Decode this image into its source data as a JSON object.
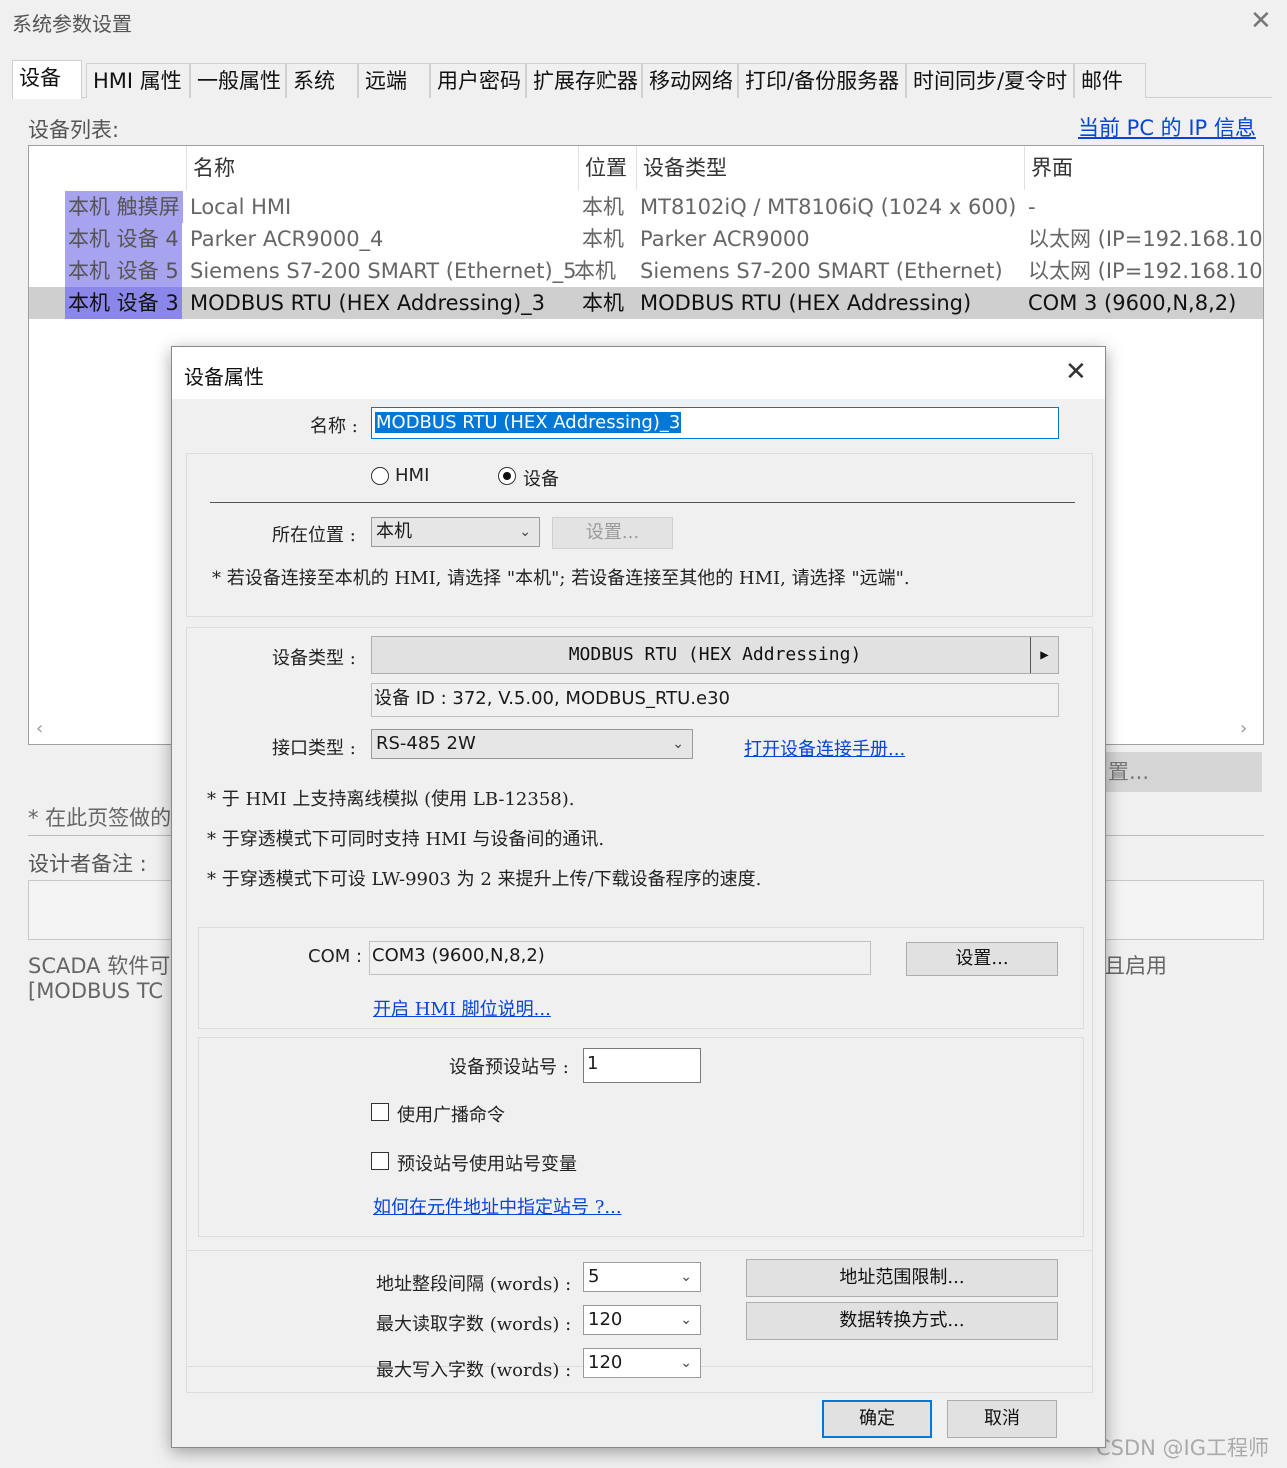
{
  "window": {
    "title": "系统参数设置",
    "close_glyph": "✕"
  },
  "tabs": [
    "设备",
    "HMI 属性",
    "一般属性",
    "系统",
    "远端",
    "用户密码",
    "扩展存贮器",
    "移动网络",
    "打印/备份服务器",
    "时间同步/夏令时",
    "邮件"
  ],
  "device_list": {
    "label": "设备列表:",
    "pc_ip_link": "当前 PC 的 IP 信息",
    "columns": [
      "名称",
      "位置",
      "设备类型",
      "界面"
    ],
    "rows": [
      {
        "loc": "本机 触摸屏",
        "name": "Local HMI",
        "pos": "本机",
        "type": "MT8102iQ / MT8106iQ (1024 x 600)",
        "iface": "-"
      },
      {
        "loc": "本机 设备 4",
        "name": "Parker ACR9000_4",
        "pos": "本机",
        "type": "Parker ACR9000",
        "iface": "以太网 (IP=192.168.10."
      },
      {
        "loc": "本机 设备 5",
        "name": "Siemens S7-200 SMART (Ethernet)_5",
        "pos": "本机",
        "type": "Siemens S7-200 SMART (Ethernet)",
        "iface": "以太网 (IP=192.168.10."
      },
      {
        "loc": "本机 设备 3",
        "name": "MODBUS RTU (HEX Addressing)_3",
        "pos": "本机",
        "type": "MODBUS RTU (HEX Addressing)",
        "iface": "COM 3 (9600,N,8,2)"
      }
    ],
    "selected_index": 3
  },
  "background": {
    "partial_button": "置...",
    "note_partial": "* 在此页签做的",
    "designer_label": "设计者备注 :",
    "scada_line1": "SCADA 软件可",
    "scada_line2": "[MODBUS TC",
    "scada_right": "且启用"
  },
  "dialog": {
    "title": "设备属性",
    "close_glyph": "✕",
    "name_label": "名称 :",
    "name_value": "MODBUS RTU (HEX Addressing)_3",
    "radio_hmi": "HMI",
    "radio_device": "设备",
    "radio_selected": "设备",
    "location_label": "所在位置 :",
    "location_value": "本机",
    "location_settings_btn": "设置...",
    "location_note": "* 若设备连接至本机的 HMI, 请选择 \"本机\"; 若设备连接至其他的 HMI, 请选择 \"远端\".",
    "device_type_label": "设备类型 :",
    "device_type_value": "MODBUS RTU (HEX Addressing)",
    "device_id": "设备 ID : 372, V.5.00, MODBUS_RTU.e30",
    "interface_label": "接口类型 :",
    "interface_value": "RS-485 2W",
    "manual_link": "打开设备连接手册...",
    "notes": [
      "* 于 HMI 上支持离线模拟 (使用 LB-12358).",
      "* 于穿透模式下可同时支持 HMI 与设备间的通讯.",
      "* 于穿透模式下可设 LW-9903 为 2 来提升上传/下载设备程序的速度."
    ],
    "com_label": "COM :",
    "com_value": "COM3 (9600,N,8,2)",
    "com_settings_btn": "设置...",
    "pin_link": "开启 HMI 脚位说明...",
    "station_label": "设备预设站号 :",
    "station_value": "1",
    "broadcast_label": "使用广播命令",
    "station_var_label": "预设站号使用站号变量",
    "station_link": "如何在元件地址中指定站号 ?...",
    "addr_interval_label": "地址整段间隔 (words) :",
    "addr_interval_value": "5",
    "max_read_label": "最大读取字数 (words) :",
    "max_read_value": "120",
    "max_write_label": "最大写入字数 (words) :",
    "max_write_value": "120",
    "addr_range_btn": "地址范围限制...",
    "data_conv_btn": "数据转换方式...",
    "ok_btn": "确定",
    "cancel_btn": "取消"
  },
  "watermark": "CSDN @IG工程师",
  "colors": {
    "link": "#0645d8",
    "selection_loc": "#8b86ea",
    "loc_bg": "#a7a3ef",
    "selected_row": "#cfcfcf"
  }
}
